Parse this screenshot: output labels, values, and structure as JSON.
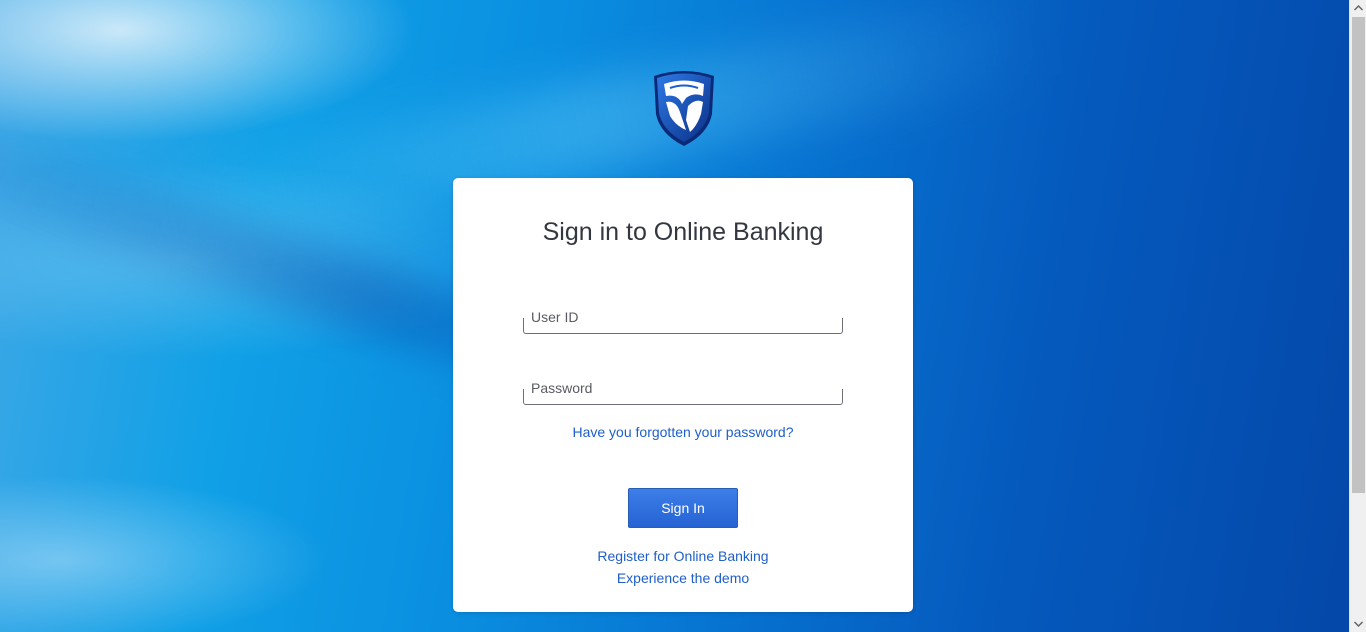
{
  "brand": {
    "logo_icon": "standard-bank-shield-icon",
    "colors": {
      "shield_dark": "#0b2f86",
      "shield_mid": "#1a5fcf",
      "link": "#1f5fc8",
      "button": "#2f6fdf"
    }
  },
  "login": {
    "title": "Sign in to Online Banking",
    "user_id_placeholder": "User ID",
    "user_id_value": "",
    "password_placeholder": "Password",
    "password_value": "",
    "forgot_password_link": "Have you forgotten your password?",
    "sign_in_button": "Sign In",
    "register_link": "Register for Online Banking",
    "demo_link": "Experience the demo"
  },
  "scrollbar": {
    "up_icon": "chevron-up-icon",
    "down_icon": "chevron-down-icon"
  }
}
